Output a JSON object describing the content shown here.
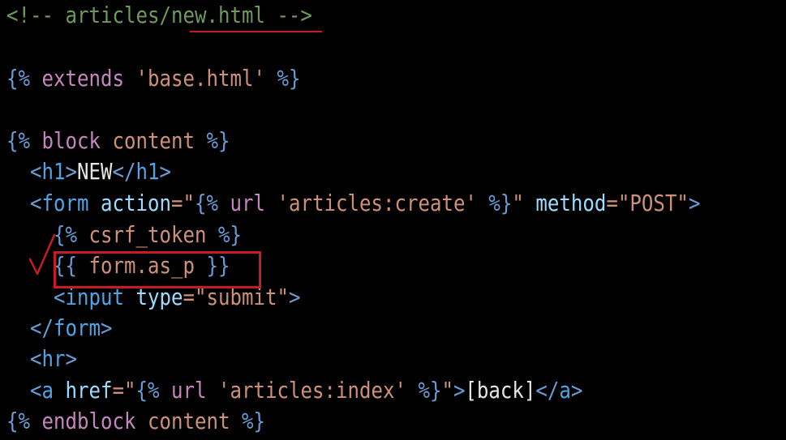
{
  "colors": {
    "background": "#000000",
    "comment": "#6e9a5b",
    "tag": "#6a9bd4",
    "keyword": "#c586c0",
    "string": "#ce9178",
    "text": "#e6e6e6",
    "annotation": "#c51d21"
  },
  "icons": {
    "check": "checkmark-icon"
  },
  "code": {
    "l1": {
      "comment": "<!-- articles/new.html -->"
    },
    "l3": {
      "open": "{%",
      "kw": "extends",
      "str": "'base.html'",
      "close": "%}"
    },
    "l5": {
      "open": "{%",
      "kw": "block",
      "name": "content",
      "close": "%}"
    },
    "l6": {
      "open": "<",
      "tag": "h1",
      "gt": ">",
      "text": "NEW",
      "copen": "</",
      "ctag": "h1",
      "cgt": ">"
    },
    "l7": {
      "open": "<",
      "tag": "form",
      "attr1": "action",
      "eq1": "=\"",
      "tpl_open": "{%",
      "kw": "url",
      "str": "'articles:create'",
      "tpl_close": "%}",
      "q1": "\"",
      "attr2": "method",
      "eq2": "=\"",
      "val2": "POST",
      "q2": "\"",
      "gt": ">"
    },
    "l8": {
      "open": "{%",
      "kw": "csrf_token",
      "close": "%}"
    },
    "l9": {
      "open": "{{",
      "var": "form.as_p",
      "close": "}}"
    },
    "l10": {
      "open": "<",
      "tag": "input",
      "attr": "type",
      "eq": "=\"",
      "val": "submit",
      "q": "\"",
      "gt": ">"
    },
    "l11": {
      "open": "</",
      "tag": "form",
      "gt": ">"
    },
    "l12": {
      "open": "<",
      "tag": "hr",
      "gt": ">"
    },
    "l13": {
      "open": "<",
      "tag": "a",
      "attr": "href",
      "eq": "=\"",
      "tpl_open": "{%",
      "kw": "url",
      "str": "'articles:index'",
      "tpl_close": "%}",
      "q": "\"",
      "gt": ">",
      "text": "[back]",
      "copen": "</",
      "ctag": "a",
      "cgt": ">"
    },
    "l14": {
      "open": "{%",
      "kw": "endblock",
      "name": "content",
      "close": "%}"
    }
  }
}
